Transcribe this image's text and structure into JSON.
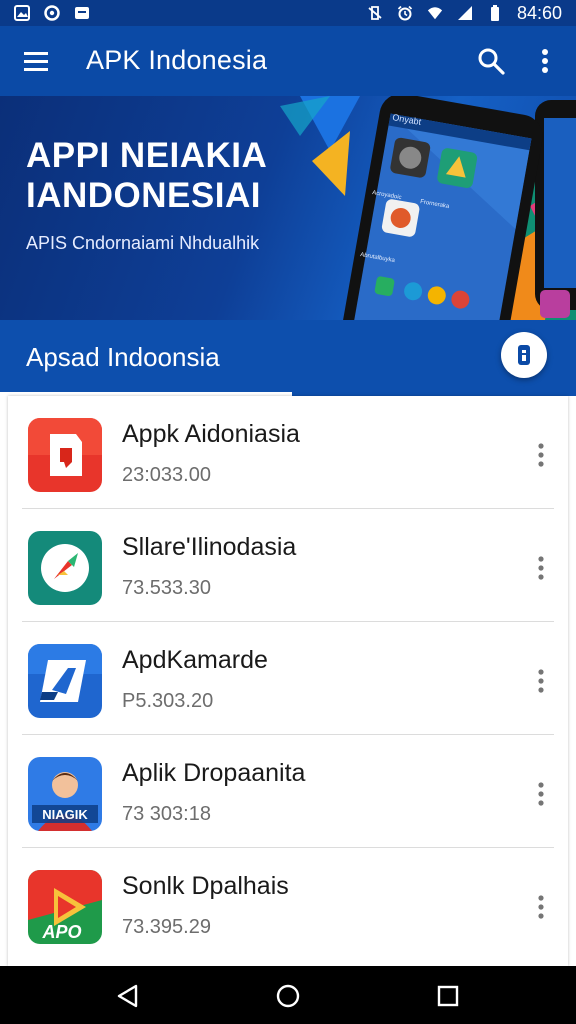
{
  "status_bar": {
    "time": "84:60",
    "left_icons": [
      "image-icon",
      "circle-record-icon",
      "message-icon"
    ],
    "right_icons": [
      "vibrate-icon",
      "alarm-icon",
      "wifi-icon",
      "signal-icon",
      "battery-icon"
    ]
  },
  "app_bar": {
    "title": "APK Indonesia",
    "menu_icon": "hamburger-menu-icon",
    "search_icon": "search-icon",
    "more_icon": "more-vert-icon"
  },
  "hero": {
    "title_line1": "APPI NEIAKIA",
    "title_line2": "IANDONESIAI",
    "subtitle": "APIS Cndornaiami Nhdualhik",
    "phone_screen_label": "Onyabt",
    "phone_app_labels": [
      "Acroyadoic",
      "Frorneraka",
      "Abrutalbuyka"
    ]
  },
  "section": {
    "title": "Apsad Indoonsia",
    "fab_icon": "info-icon"
  },
  "apps": [
    {
      "name": "Appk Aidoniasia",
      "price": "23:033.00",
      "icon": "red-box-app-icon",
      "colors": [
        "#f2392b",
        "#d8261a"
      ]
    },
    {
      "name": "Sllare'Ilinodasia",
      "price": "73.533.30",
      "icon": "compass-app-icon",
      "colors": [
        "#1b9a87",
        "#0e6f63"
      ]
    },
    {
      "name": "ApdKamarde",
      "price": "P5.303.20",
      "icon": "shopping-app-icon",
      "colors": [
        "#1f6fd6",
        "#1552ad"
      ]
    },
    {
      "name": "Aplik Dropaanita",
      "price": "73 303:18",
      "icon": "character-app-icon",
      "icon_text": "NIAGIK",
      "colors": [
        "#2f7be6",
        "#1a4fb0"
      ]
    },
    {
      "name": "Sonlk Dpalhais",
      "price": "73.395.29",
      "icon": "play-app-icon",
      "icon_text": "APO",
      "colors": [
        "#e8352b",
        "#1f9a4a"
      ]
    }
  ],
  "nav_bar": {
    "back_icon": "back-triangle-icon",
    "home_icon": "home-circle-icon",
    "recents_icon": "recents-square-icon"
  },
  "theme": {
    "primary": "#0b4aa6",
    "primary_dark": "#0a3a8a"
  }
}
